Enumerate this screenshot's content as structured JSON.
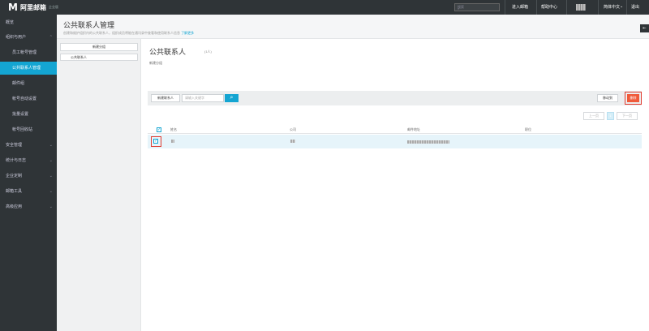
{
  "topbar": {
    "logo_mark": "M",
    "logo_text": "阿里邮箱",
    "logo_sub": "企业版",
    "search_placeholder": "搜索",
    "enter_mail": "进入邮箱",
    "help": "帮助中心",
    "language": "简体中文",
    "logout": "退出"
  },
  "sidebar": {
    "items": [
      {
        "label": "概览"
      },
      {
        "label": "组织与用户"
      },
      {
        "label": "员工帐号管理"
      },
      {
        "label": "公共联系人管理"
      },
      {
        "label": "邮件组"
      },
      {
        "label": "帐号自动设置"
      },
      {
        "label": "批量设置"
      },
      {
        "label": "帐号回收站"
      },
      {
        "label": "安全管理"
      },
      {
        "label": "统计与日志"
      },
      {
        "label": "企业定制"
      },
      {
        "label": "邮箱工具"
      },
      {
        "label": "高级应用"
      }
    ]
  },
  "page": {
    "title": "公共联系人管理",
    "desc": "创建和维护组织内的公共联系人，组织成员将能在通讯录中查看和使用联系人信息",
    "more_link": "了解更多"
  },
  "groups": {
    "new_group": "新建分组",
    "items": [
      "公共联系人"
    ]
  },
  "content": {
    "title": "公共联系人",
    "count": "(1人)",
    "new_group": "新建分组",
    "new_contact": "新建联系人",
    "search_placeholder": "请输入关键字",
    "move_to": "移动到",
    "delete": "删除",
    "prev": "上一页",
    "page": "1",
    "next": "下一页",
    "columns": [
      "姓名",
      "公司",
      "邮件地址",
      "职位"
    ]
  },
  "colors": {
    "accent": "#14a5d2",
    "sidebar_bg": "#2f3437",
    "delete": "#f05a3a",
    "highlight_border": "#e03b2f"
  }
}
